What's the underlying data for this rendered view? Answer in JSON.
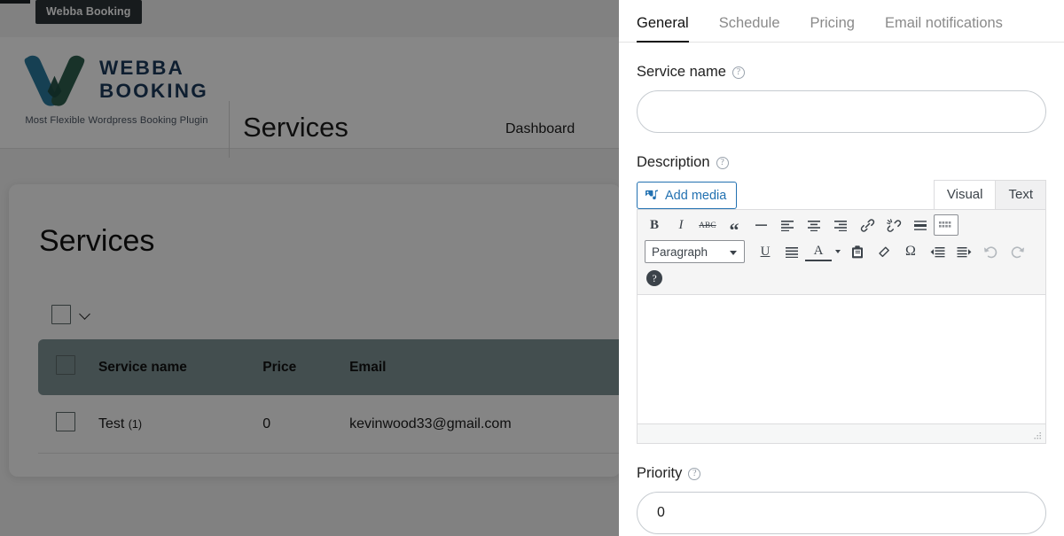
{
  "admin": {
    "tooltip": "Webba Booking"
  },
  "brand": {
    "line1": "WEBBA",
    "line2": "BOOKING",
    "tagline": "Most Flexible Wordpress Booking Plugin",
    "logo_blue": "#2b7a9e",
    "logo_green": "#2f5f4f"
  },
  "header": {
    "title": "Services",
    "nav_dashboard": "Dashboard"
  },
  "card": {
    "title": "Services",
    "table": {
      "header_accent": "#7f9395",
      "columns": [
        "Service name",
        "Price",
        "Email"
      ],
      "rows": [
        {
          "name": "Test",
          "count": "(1)",
          "price": "0",
          "email": "kevinwood33@gmail.com"
        }
      ]
    }
  },
  "panel": {
    "tabs": [
      {
        "label": "General",
        "active": true
      },
      {
        "label": "Schedule",
        "active": false
      },
      {
        "label": "Pricing",
        "active": false
      },
      {
        "label": "Email notifications",
        "active": false
      }
    ],
    "service_name": {
      "label": "Service name",
      "value": "",
      "placeholder": ""
    },
    "description": {
      "label": "Description",
      "add_media": "Add media",
      "mode_tabs": [
        {
          "label": "Visual",
          "active": true
        },
        {
          "label": "Text",
          "active": false
        }
      ],
      "toolbar_row1": [
        {
          "name": "bold-icon",
          "glyph": "B"
        },
        {
          "name": "italic-icon",
          "glyph": "I"
        },
        {
          "name": "strikethrough-icon",
          "glyph": "ABC"
        },
        {
          "name": "blockquote-icon",
          "glyph": "“"
        },
        {
          "name": "horizontal-rule-icon",
          "glyph": "—"
        },
        {
          "name": "align-left-icon",
          "glyph": ""
        },
        {
          "name": "align-center-icon",
          "glyph": ""
        },
        {
          "name": "align-right-icon",
          "glyph": ""
        },
        {
          "name": "insert-link-icon",
          "glyph": ""
        },
        {
          "name": "remove-link-icon",
          "glyph": ""
        },
        {
          "name": "read-more-icon",
          "glyph": ""
        },
        {
          "name": "toolbar-toggle-icon",
          "glyph": ""
        }
      ],
      "paragraph_select": "Paragraph",
      "toolbar_row2": [
        {
          "name": "underline-icon",
          "glyph": "U"
        },
        {
          "name": "justify-icon",
          "glyph": ""
        },
        {
          "name": "text-color-icon",
          "glyph": "A"
        },
        {
          "name": "paste-as-text-icon",
          "glyph": ""
        },
        {
          "name": "clear-formatting-icon",
          "glyph": ""
        },
        {
          "name": "special-character-icon",
          "glyph": "Ω"
        },
        {
          "name": "outdent-icon",
          "glyph": ""
        },
        {
          "name": "indent-icon",
          "glyph": ""
        },
        {
          "name": "undo-icon",
          "glyph": ""
        },
        {
          "name": "redo-icon",
          "glyph": ""
        }
      ],
      "keyboard_help": "?",
      "content": ""
    },
    "priority": {
      "label": "Priority",
      "value": "0"
    }
  }
}
